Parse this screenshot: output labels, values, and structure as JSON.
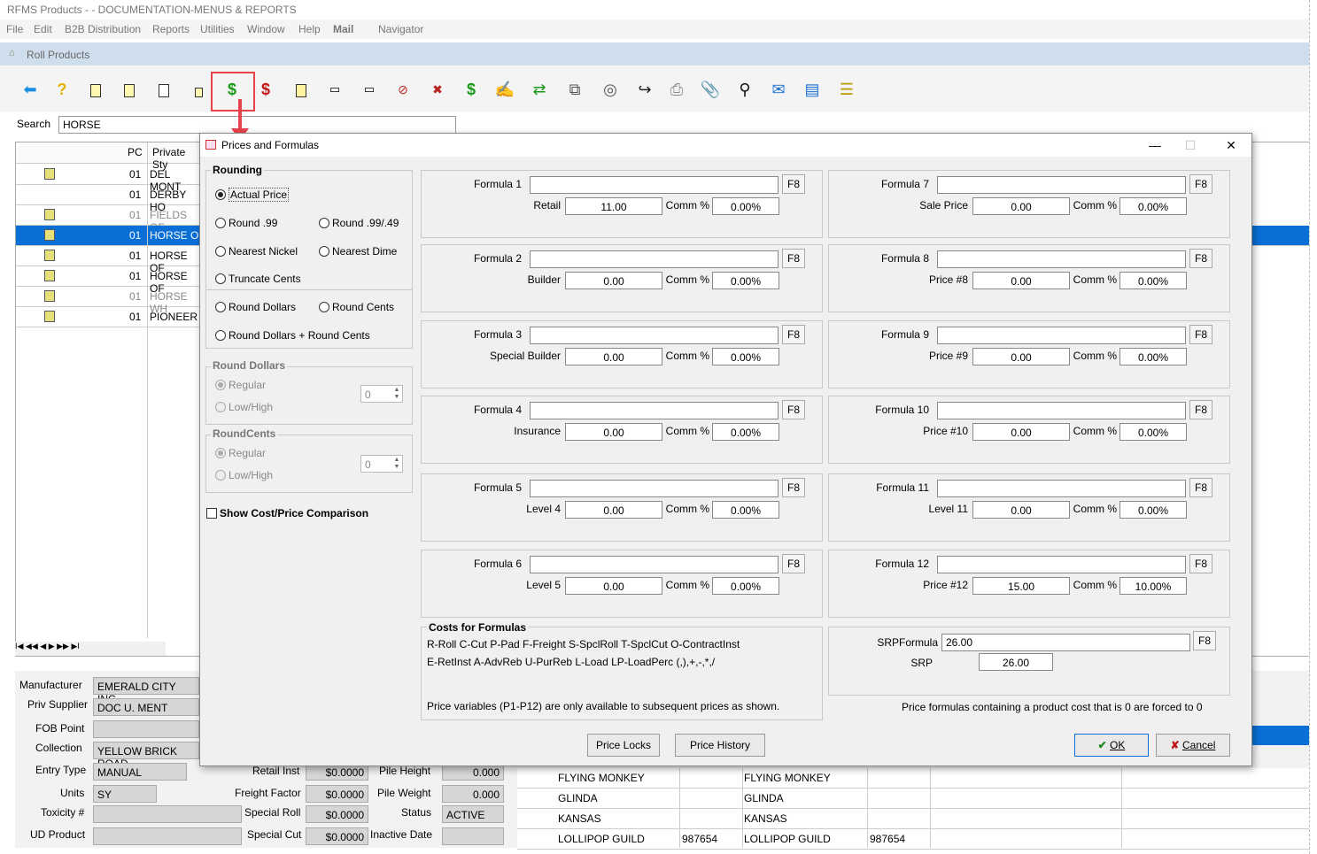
{
  "app": {
    "title": "RFMS Products - - DOCUMENTATION-MENUS & REPORTS",
    "menu": [
      "File",
      "Edit",
      "B2B Distribution",
      "Reports",
      "Utilities",
      "Window",
      "Help",
      "Mail",
      "Navigator"
    ],
    "subwindow_title": "Roll Products",
    "search_label": "Search",
    "search_value": "HORSE"
  },
  "toolbar": {
    "icons": [
      "back-arrow-icon",
      "help-icon",
      "new-product-icon",
      "edit-product-icon",
      "delete-product-icon",
      "notes-icon",
      "prices-formulas-icon",
      "price-edit-icon",
      "tag-icon",
      "label-icon",
      "card-icon",
      "stop-card-icon",
      "x-card-icon",
      "money-card-icon",
      "signature-icon",
      "transfer-icon",
      "copy-icon",
      "database-icon",
      "forward-icon",
      "print-icon",
      "attach-icon",
      "find-icon",
      "email-icon",
      "window-icon",
      "notes-stack-icon"
    ]
  },
  "grid": {
    "headers": {
      "pc": "PC",
      "style": "Private Sty"
    },
    "rows": [
      {
        "pc": "01",
        "style": "DEL MONT",
        "book": true,
        "selected": false,
        "faded": false
      },
      {
        "pc": "01",
        "style": "DERBY HO",
        "book": false,
        "selected": false,
        "faded": false
      },
      {
        "pc": "01",
        "style": "FIELDS OF",
        "book": true,
        "selected": false,
        "faded": true
      },
      {
        "pc": "01",
        "style": "HORSE OF",
        "book": true,
        "selected": true,
        "faded": false
      },
      {
        "pc": "01",
        "style": "HORSE OF",
        "book": true,
        "selected": false,
        "faded": false
      },
      {
        "pc": "01",
        "style": "HORSE OF",
        "book": true,
        "selected": false,
        "faded": false
      },
      {
        "pc": "01",
        "style": "HORSE WH",
        "book": true,
        "selected": false,
        "faded": true
      },
      {
        "pc": "01",
        "style": "PIONEER",
        "book": true,
        "selected": false,
        "faded": false
      }
    ],
    "nav": "I◀ ◀◀ ◀ ▶ ▶▶ ▶I"
  },
  "bottom": {
    "manufacturer_label": "Manufacturer",
    "manufacturer": "EMERALD CITY INC",
    "priv_supplier_label": "Priv Supplier",
    "priv_supplier": "DOC U. MENT",
    "fob_label": "FOB Point",
    "fob": "",
    "collection_label": "Collection",
    "collection": "YELLOW BRICK ROAD",
    "entry_type_label": "Entry Type",
    "entry_type": "MANUAL",
    "units_label": "Units",
    "units": "SY",
    "toxicity_label": "Toxicity #",
    "toxicity": "",
    "ud_product_label": "UD Product",
    "ud_product": "",
    "retail_inst_label": "Retail Inst",
    "retail_inst": "$0.0000",
    "freight_label": "Freight Factor",
    "freight": "$0.0000",
    "special_roll_label": "Special Roll",
    "special_roll": "$0.0000",
    "special_cut_label": "Special Cut",
    "special_cut": "$0.0000",
    "pile_height_label": "Pile Height",
    "pile_height": "0.000",
    "pile_weight_label": "Pile Weight",
    "pile_weight": "0.000",
    "status_label": "Status",
    "status": "ACTIVE",
    "inactive_label": "Inactive Date",
    "inactive": "",
    "table_rows": [
      {
        "a": "FLYING MONKEY",
        "b": "",
        "c": "FLYING MONKEY",
        "d": ""
      },
      {
        "a": "GLINDA",
        "b": "",
        "c": "GLINDA",
        "d": ""
      },
      {
        "a": "KANSAS",
        "b": "",
        "c": "KANSAS",
        "d": ""
      },
      {
        "a": "LOLLIPOP GUILD",
        "b": "987654",
        "c": "LOLLIPOP GUILD",
        "d": "987654"
      }
    ]
  },
  "dialog": {
    "title": "Prices and Formulas",
    "rounding": {
      "title": "Rounding",
      "options": {
        "actual": "Actual Price",
        "r99": "Round .99",
        "r9949": "Round .99/.49",
        "nickel": "Nearest Nickel",
        "dime": "Nearest Dime",
        "truncate": "Truncate Cents",
        "dollars": "Round Dollars",
        "cents": "Round Cents",
        "dollars_cents": "Round Dollars + Round Cents"
      },
      "selected": "actual"
    },
    "round_dollars": {
      "title": "Round Dollars",
      "regular": "Regular",
      "lowhigh": "Low/High",
      "value": "0"
    },
    "round_cents": {
      "title": "RoundCents",
      "regular": "Regular",
      "lowhigh": "Low/High",
      "value": "0"
    },
    "show_compare": "Show Cost/Price Comparison",
    "f8": "F8",
    "comm_label": "Comm %",
    "formulas": [
      {
        "label": "Formula 1",
        "value": "",
        "price_label": "Retail",
        "price": "11.00",
        "comm": "0.00%"
      },
      {
        "label": "Formula 2",
        "value": "",
        "price_label": "Builder",
        "price": "0.00",
        "comm": "0.00%"
      },
      {
        "label": "Formula 3",
        "value": "",
        "price_label": "Special Builder",
        "price": "0.00",
        "comm": "0.00%"
      },
      {
        "label": "Formula 4",
        "value": "",
        "price_label": "Insurance",
        "price": "0.00",
        "comm": "0.00%"
      },
      {
        "label": "Formula 5",
        "value": "",
        "price_label": "Level 4",
        "price": "0.00",
        "comm": "0.00%"
      },
      {
        "label": "Formula 6",
        "value": "",
        "price_label": "Level 5",
        "price": "0.00",
        "comm": "0.00%"
      },
      {
        "label": "Formula 7",
        "value": "",
        "price_label": "Sale Price",
        "price": "0.00",
        "comm": "0.00%"
      },
      {
        "label": "Formula 8",
        "value": "",
        "price_label": "Price #8",
        "price": "0.00",
        "comm": "0.00%"
      },
      {
        "label": "Formula 9",
        "value": "",
        "price_label": "Price #9",
        "price": "0.00",
        "comm": "0.00%"
      },
      {
        "label": "Formula 10",
        "value": "",
        "price_label": "Price #10",
        "price": "0.00",
        "comm": "0.00%"
      },
      {
        "label": "Formula 11",
        "value": "",
        "price_label": "Level 11",
        "price": "0.00",
        "comm": "0.00%"
      },
      {
        "label": "Formula 12",
        "value": "",
        "price_label": "Price #12",
        "price": "15.00",
        "comm": "10.00%"
      }
    ],
    "costs": {
      "title": "Costs for Formulas",
      "line1": "R-Roll  C-Cut P-Pad F-Freight S-SpclRoll T-SpclCut O-ContractInst",
      "line2": "E-RetInst  A-AdvReb  U-PurReb  L-Load  LP-LoadPerc  (,),+,-,*,/",
      "line3": "Price variables (P1-P12) are only available to subsequent prices as shown."
    },
    "srp": {
      "formula_label": "SRPFormula",
      "formula": "26.00",
      "srp_label": "SRP",
      "srp": "26.00"
    },
    "note": "Price formulas containing a product cost that is 0 are forced to 0",
    "buttons": {
      "locks": "Price Locks",
      "history": "Price History",
      "ok": "OK",
      "cancel": "Cancel"
    }
  }
}
